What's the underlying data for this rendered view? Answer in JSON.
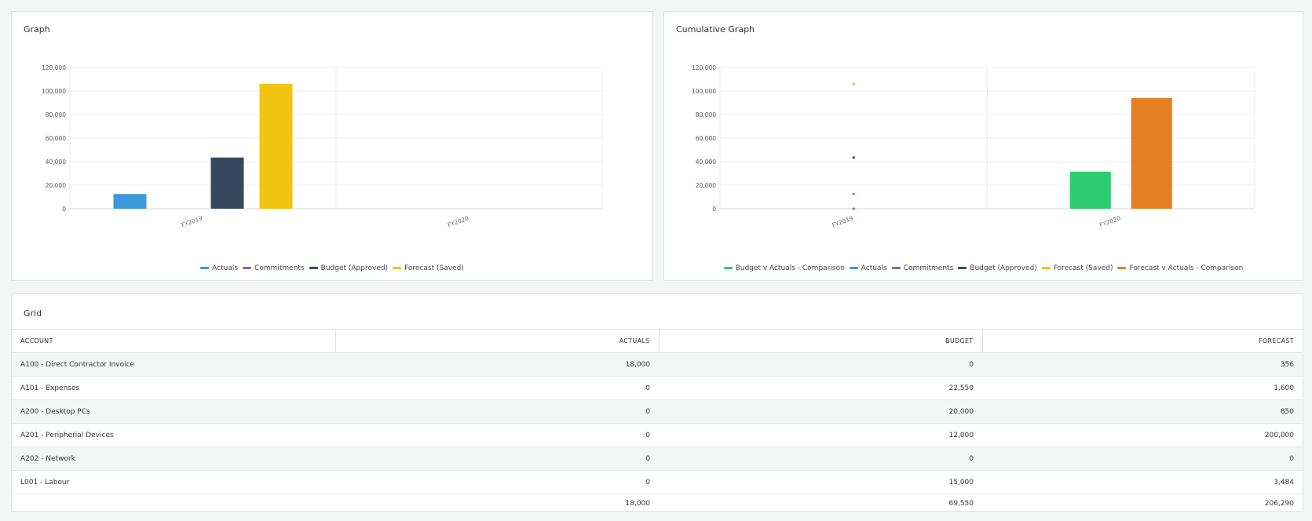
{
  "graph": {
    "title": "Graph",
    "legend": [
      {
        "name": "Actuals",
        "color": "#3b99dc"
      },
      {
        "name": "Commitments",
        "color": "#9b59b6"
      },
      {
        "name": "Budget (Approved)",
        "color": "#34495e"
      },
      {
        "name": "Forecast (Saved)",
        "color": "#f1c40f"
      }
    ]
  },
  "cumulative": {
    "title": "Cumulative Graph",
    "legend": [
      {
        "name": "Budget v Actuals - Comparison",
        "color": "#2ecc71"
      },
      {
        "name": "Actuals",
        "color": "#3b99dc"
      },
      {
        "name": "Commitments",
        "color": "#9b59b6"
      },
      {
        "name": "Budget (Approved)",
        "color": "#34495e"
      },
      {
        "name": "Forecast (Saved)",
        "color": "#f1c40f"
      },
      {
        "name": "Forecast v Actuals - Comparison",
        "color": "#e67e22"
      }
    ]
  },
  "chart_data": [
    {
      "type": "bar",
      "title": "Graph",
      "categories": [
        "FY2019",
        "FY2020"
      ],
      "yticks": [
        "0",
        "20,000",
        "40,000",
        "60,000",
        "80,000",
        "100,000",
        "120,000"
      ],
      "ylim": [
        0,
        120000
      ],
      "series": [
        {
          "name": "Actuals",
          "color": "#3b99dc",
          "values": [
            12500,
            0
          ]
        },
        {
          "name": "Commitments",
          "color": "#9b59b6",
          "values": [
            0,
            0
          ]
        },
        {
          "name": "Budget (Approved)",
          "color": "#34495e",
          "values": [
            43500,
            0
          ]
        },
        {
          "name": "Forecast (Saved)",
          "color": "#f1c40f",
          "values": [
            106000,
            0
          ]
        }
      ]
    },
    {
      "type": "bar",
      "title": "Cumulative Graph",
      "categories": [
        "FY2019",
        "FY2020"
      ],
      "yticks": [
        "0",
        "20,000",
        "40,000",
        "60,000",
        "80,000",
        "100,000",
        "120,000"
      ],
      "ylim": [
        0,
        120000
      ],
      "bars": [
        {
          "name": "Budget v Actuals - Comparison",
          "color": "#2ecc71",
          "values": [
            0,
            31500
          ]
        },
        {
          "name": "Forecast v Actuals - Comparison",
          "color": "#e67e22",
          "values": [
            0,
            94000
          ]
        }
      ],
      "points": [
        {
          "name": "Forecast (Saved)",
          "color": "#f1c40f",
          "values": [
            106000,
            null
          ]
        },
        {
          "name": "Budget (Approved)",
          "color": "#34495e",
          "values": [
            43500,
            null
          ]
        },
        {
          "name": "Actuals",
          "color": "#3b99dc",
          "values": [
            12500,
            null
          ]
        },
        {
          "name": "Commitments",
          "color": "#9b59b6",
          "values": [
            0,
            null
          ]
        }
      ]
    }
  ],
  "grid": {
    "title": "Grid",
    "columns": [
      "ACCOUNT",
      "ACTUALS",
      "BUDGET",
      "FORECAST"
    ],
    "rows": [
      [
        "A100 - Direct Contractor Invoice",
        "18,000",
        "0",
        "356"
      ],
      [
        "A101 - Expenses",
        "0",
        "22,550",
        "1,600"
      ],
      [
        "A200 - Desktop PCs",
        "0",
        "20,000",
        "850"
      ],
      [
        "A201 - Peripherial Devices",
        "0",
        "12,000",
        "200,000"
      ],
      [
        "A202 - Network",
        "0",
        "0",
        "0"
      ],
      [
        "L001 - Labour",
        "0",
        "15,000",
        "3,484"
      ]
    ],
    "totals": [
      "",
      "18,000",
      "69,550",
      "206,290"
    ]
  }
}
